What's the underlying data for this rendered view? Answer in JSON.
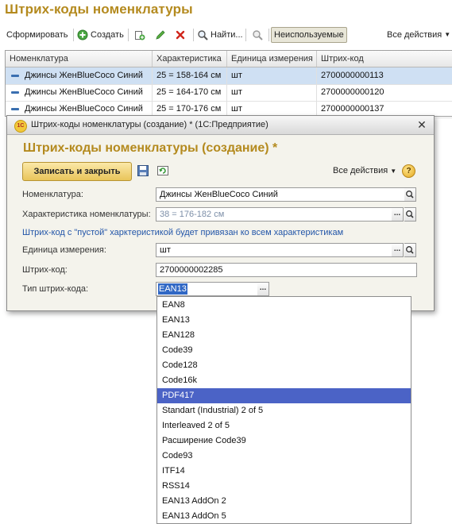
{
  "main": {
    "title": "Штрих-коды номенклатуры",
    "toolbar": {
      "generate": "Сформировать",
      "create": "Создать",
      "find": "Найти...",
      "unused": "Неиспользуемые",
      "all_actions": "Все действия"
    },
    "table": {
      "columns": [
        "Номенклатура",
        "Характеристика",
        "Единица измерения",
        "Штрих-код"
      ],
      "rows": [
        [
          "Джинсы ЖенBlueCoco Синий",
          "25 = 158-164 см",
          "шт",
          "2700000000113"
        ],
        [
          "Джинсы ЖенBlueCoco Синий",
          "25 = 164-170 см",
          "шт",
          "2700000000120"
        ],
        [
          "Джинсы ЖенBlueCoco Синий",
          "25 = 170-176 см",
          "шт",
          "2700000000137"
        ]
      ]
    }
  },
  "dialog": {
    "window_title": "Штрих-коды номенклатуры (создание) *  (1С:Предприятие)",
    "logo_text": "1С",
    "heading": "Штрих-коды номенклатуры (создание) *",
    "save_close": "Записать и закрыть",
    "all_actions": "Все действия",
    "help": "?",
    "fields": {
      "nomenclature_label": "Номенклатура:",
      "nomenclature_value": "Джинсы ЖенBlueCoco Синий",
      "characteristic_label": "Характеристика номенклатуры:",
      "characteristic_placeholder": "38 = 176-182 см",
      "note": "Штрих-код с \"пустой\" харктеристикой будет привязан ко всем характеристикам",
      "unit_label": "Единица измерения:",
      "unit_value": "шт",
      "barcode_label": "Штрих-код:",
      "barcode_value": "2700000002285",
      "barcode_type_label": "Тип штрих-кода:",
      "barcode_type_value": "EAN13"
    }
  },
  "dropdown": {
    "options": [
      "EAN8",
      "EAN13",
      "EAN128",
      "Code39",
      "Code128",
      "Code16k",
      "PDF417",
      "Standart (Industrial) 2 of 5",
      "Interleaved 2 of 5",
      "Расширение Code39",
      "Code93",
      "ITF14",
      "RSS14",
      "EAN13 AddOn 2",
      "EAN13 AddOn 5"
    ],
    "highlighted": "PDF417"
  },
  "colors": {
    "title_gold": "#b48a1e",
    "row_selected": "#cfe0f3",
    "dropdown_highlight": "#4b63c6",
    "selection_blue": "#3168c5",
    "note_blue": "#2255a8"
  }
}
